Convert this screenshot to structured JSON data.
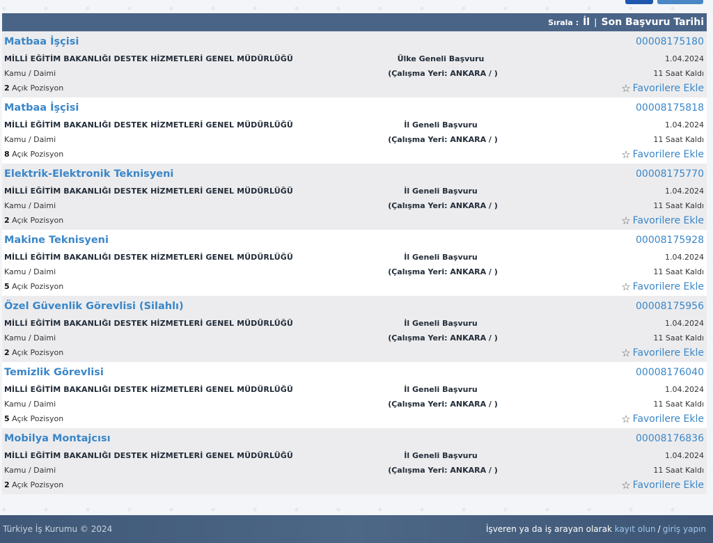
{
  "sort": {
    "label": "Sırala :",
    "option_1": "İl",
    "separator": "|",
    "option_2": "Son Başvuru Tarihi"
  },
  "jobs": [
    {
      "title": "Matbaa İşçisi",
      "org": "MİLLİ EĞİTİM BAKANLIĞI DESTEK HİZMETLERİ GENEL MÜDÜRLÜĞÜ",
      "type": "Kamu / Daimi",
      "positions_count": "2",
      "positions_label": "Açık Pozisyon",
      "scope": "Ülke Geneli Başvuru",
      "location": "(Çalışma Yeri: ANKARA / )",
      "id": "00008175180",
      "date": "1.04.2024",
      "remaining": "11 Saat Kaldı",
      "fav": "Favorilere Ekle"
    },
    {
      "title": "Matbaa İşçisi",
      "org": "MİLLİ EĞİTİM BAKANLIĞI DESTEK HİZMETLERİ GENEL MÜDÜRLÜĞÜ",
      "type": "Kamu / Daimi",
      "positions_count": "8",
      "positions_label": "Açık Pozisyon",
      "scope": "İl Geneli Başvuru",
      "location": "(Çalışma Yeri: ANKARA / )",
      "id": "00008175818",
      "date": "1.04.2024",
      "remaining": "11 Saat Kaldı",
      "fav": "Favorilere Ekle"
    },
    {
      "title": "Elektrik-Elektronik Teknisyeni",
      "org": "MİLLİ EĞİTİM BAKANLIĞI DESTEK HİZMETLERİ GENEL MÜDÜRLÜĞÜ",
      "type": "Kamu / Daimi",
      "positions_count": "2",
      "positions_label": "Açık Pozisyon",
      "scope": "İl Geneli Başvuru",
      "location": "(Çalışma Yeri: ANKARA / )",
      "id": "00008175770",
      "date": "1.04.2024",
      "remaining": "11 Saat Kaldı",
      "fav": "Favorilere Ekle"
    },
    {
      "title": "Makine Teknisyeni",
      "org": "MİLLİ EĞİTİM BAKANLIĞI DESTEK HİZMETLERİ GENEL MÜDÜRLÜĞÜ",
      "type": "Kamu / Daimi",
      "positions_count": "5",
      "positions_label": "Açık Pozisyon",
      "scope": "İl Geneli Başvuru",
      "location": "(Çalışma Yeri: ANKARA / )",
      "id": "00008175928",
      "date": "1.04.2024",
      "remaining": "11 Saat Kaldı",
      "fav": "Favorilere Ekle"
    },
    {
      "title": "Özel Güvenlik Görevlisi (Silahlı)",
      "org": "MİLLİ EĞİTİM BAKANLIĞI DESTEK HİZMETLERİ GENEL MÜDÜRLÜĞÜ",
      "type": "Kamu / Daimi",
      "positions_count": "2",
      "positions_label": "Açık Pozisyon",
      "scope": "İl Geneli Başvuru",
      "location": "(Çalışma Yeri: ANKARA / )",
      "id": "00008175956",
      "date": "1.04.2024",
      "remaining": "11 Saat Kaldı",
      "fav": "Favorilere Ekle"
    },
    {
      "title": "Temizlik Görevlisi",
      "org": "MİLLİ EĞİTİM BAKANLIĞI DESTEK HİZMETLERİ GENEL MÜDÜRLÜĞÜ",
      "type": "Kamu / Daimi",
      "positions_count": "5",
      "positions_label": "Açık Pozisyon",
      "scope": "İl Geneli Başvuru",
      "location": "(Çalışma Yeri: ANKARA / )",
      "id": "00008176040",
      "date": "1.04.2024",
      "remaining": "11 Saat Kaldı",
      "fav": "Favorilere Ekle"
    },
    {
      "title": "Mobilya Montajcısı",
      "org": "MİLLİ EĞİTİM BAKANLIĞI DESTEK HİZMETLERİ GENEL MÜDÜRLÜĞÜ",
      "type": "Kamu / Daimi",
      "positions_count": "2",
      "positions_label": "Açık Pozisyon",
      "scope": "İl Geneli Başvuru",
      "location": "(Çalışma Yeri: ANKARA / )",
      "id": "00008176836",
      "date": "1.04.2024",
      "remaining": "11 Saat Kaldı",
      "fav": "Favorilere Ekle"
    }
  ],
  "footer": {
    "copyright": "Türkiye İş Kurumu © 2024",
    "cta_prefix": "İşveren ya da iş arayan olarak",
    "register_link": "kayıt olun",
    "slash": "/",
    "login_link": "giriş yapın"
  },
  "icons": {
    "favorite": "star-outline-icon"
  },
  "colors": {
    "link": "#3a86c8",
    "header_bar": "#4a6487",
    "footer": "#435d7c"
  }
}
